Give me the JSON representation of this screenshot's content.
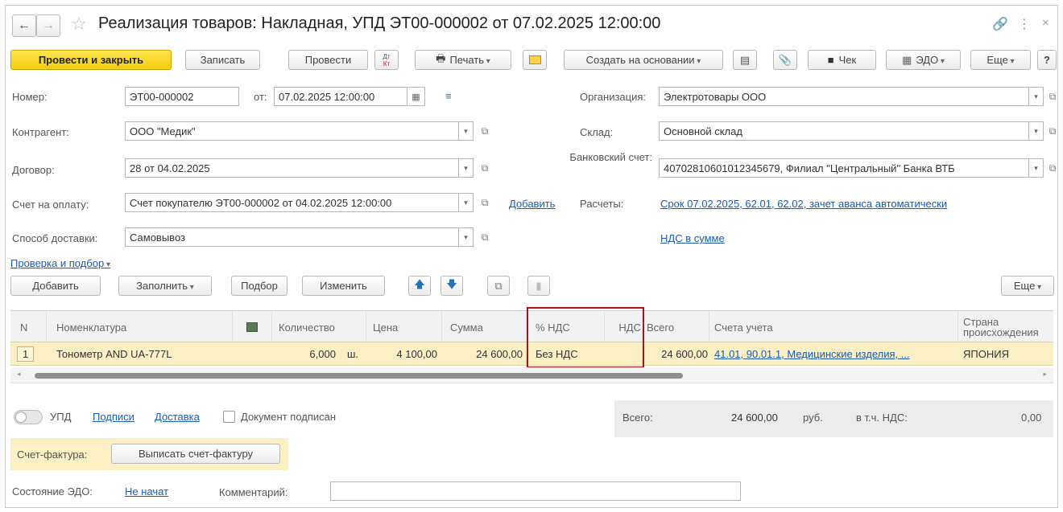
{
  "window": {
    "title": "Реализация товаров: Накладная, УПД ЭТ00-000002 от 07.02.2025 12:00:00"
  },
  "toolbar": {
    "post_close": "Провести и закрыть",
    "save": "Записать",
    "post": "Провести",
    "dtkt_top": "Дт",
    "dtkt_bottom": "Кт",
    "print": "Печать",
    "create_based": "Создать на основании",
    "receipt": "Чек",
    "edo": "ЭДО",
    "more": "Еще",
    "help": "?"
  },
  "form": {
    "number_label": "Номер:",
    "number_value": "ЭТ00-000002",
    "date_label": "от:",
    "date_value": "07.02.2025 12:00:00",
    "org_label": "Организация:",
    "org_value": "Электротовары ООО",
    "counterparty_label": "Контрагент:",
    "counterparty_value": "ООО \"Медик\"",
    "warehouse_label": "Склад:",
    "warehouse_value": "Основной склад",
    "contract_label": "Договор:",
    "contract_value": "28 от 04.02.2025",
    "bank_label": "Банковский счет:",
    "bank_value": "40702810601012345679, Филиал \"Центральный\" Банка ВТБ",
    "invoice_label": "Счет на оплату:",
    "invoice_value": "Счет покупателю ЭТ00-000002 от 04.02.2025 12:00:00",
    "add_link": "Добавить",
    "settlements_label": "Расчеты:",
    "settlements_link": "Срок 07.02.2025, 62.01, 62.02, зачет аванса автоматически",
    "delivery_label": "Способ доставки:",
    "delivery_value": "Самовывоз",
    "vat_link": "НДС в сумме",
    "check_link": "Проверка и подбор"
  },
  "table_toolbar": {
    "add": "Добавить",
    "fill": "Заполнить",
    "pick": "Подбор",
    "change": "Изменить",
    "more": "Еще"
  },
  "table": {
    "columns": {
      "n": "N",
      "nomenclature": "Номенклатура",
      "qty": "Количество",
      "price": "Цена",
      "sum": "Сумма",
      "vat_rate": "% НДС",
      "vat": "НДС",
      "total": "Всего",
      "accounts": "Счета учета",
      "country": "Страна происхождения"
    },
    "rows": [
      {
        "n": "1",
        "nomenclature": "Тонометр AND UA-777L",
        "qty": "6,000",
        "unit": "ш.",
        "price": "4 100,00",
        "sum": "24 600,00",
        "vat_rate": "Без НДС",
        "vat": "",
        "total": "24 600,00",
        "accounts": "41.01, 90.01.1, Медицинские изделия, ...",
        "country": "ЯПОНИЯ"
      }
    ]
  },
  "footer": {
    "upd": "УПД",
    "signatures": "Подписи",
    "delivery": "Доставка",
    "signed": "Документ подписан",
    "total_label": "Всего:",
    "total_value": "24 600,00",
    "currency": "руб.",
    "vat_label": "в т.ч. НДС:",
    "vat_value": "0,00",
    "sf_label": "Счет-фактура:",
    "sf_button": "Выписать счет-фактуру",
    "edo_state_label": "Состояние ЭДО:",
    "edo_state_link": "Не начат",
    "comment_label": "Комментарий:",
    "comment_value": ""
  },
  "colors": {
    "primary_button": "#f5cd0a",
    "selected_row": "#fbefc4",
    "highlight_box": "#b4121b",
    "link": "#1a5bb5"
  }
}
